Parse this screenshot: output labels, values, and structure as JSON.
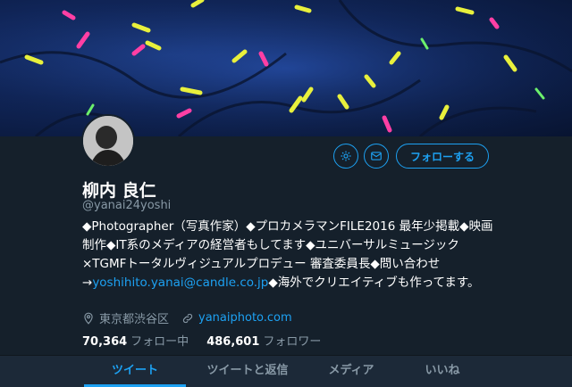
{
  "profile": {
    "name": "柳内 良仁",
    "handle": "@yanai24yoshi",
    "follow_label": "フォローする",
    "bio_text": "◆Photographer（写真作家）◆プロカメラマンFILE2016 最年少掲載◆映画制作◆IT系のメディアの経営者もしてます◆ユニバーサルミュージック×TGMFトータルヴィジュアルプロデュー 審査委員長◆問い合わせ→",
    "bio_email": "yoshihito.yanai@candle.co.jp",
    "bio_tail": "◆海外でクリエイティブも作ってます。",
    "location": "東京都渋谷区",
    "website": "yanaiphoto.com",
    "following_count": "70,364",
    "following_label": "フォロー中",
    "followers_count": "486,601",
    "followers_label": "フォロワー"
  },
  "tabs": [
    {
      "label": "ツイート",
      "active": true
    },
    {
      "label": "ツイートと返信",
      "active": false
    },
    {
      "label": "メディア",
      "active": false
    },
    {
      "label": "いいね",
      "active": false
    }
  ],
  "icons": {
    "settings": "gear-icon",
    "message": "mail-icon",
    "location": "location-pin-icon",
    "website": "link-icon"
  },
  "colors": {
    "background": "#15202b",
    "accent": "#1da1f2",
    "muted": "#8899a6",
    "tab_bar": "#1c2938"
  }
}
